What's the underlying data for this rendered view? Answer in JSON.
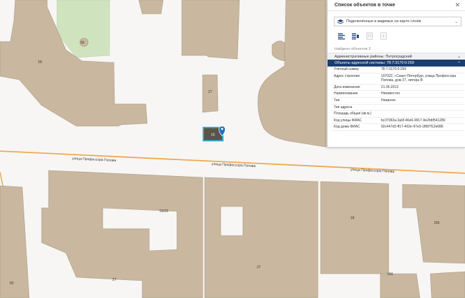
{
  "map": {
    "street_label": "улица Профессора Попова",
    "building_numbers": [
      "55",
      "55",
      "27",
      "15",
      "53/22",
      "18",
      "166",
      "166",
      "27",
      "27",
      "50"
    ],
    "colors": {
      "background": "#f7f6f4",
      "building": "#c9b89f",
      "building_outline": "#a89885",
      "park": "#cfe3bf",
      "street_line": "#f0a850",
      "highlight": "#3aa6c9",
      "marker": "#1e73be"
    },
    "marker_icon": "map-pin-icon"
  },
  "panel": {
    "title": "Список объектов в точке",
    "close_icon": "close-icon",
    "layer_select": {
      "icon": "layers-icon",
      "value": "Подключённые и видимых на карте слоёв"
    },
    "tools": [
      {
        "name": "list-view-icon",
        "enabled": true
      },
      {
        "name": "grouped-list-icon",
        "enabled": true
      },
      {
        "name": "document-icon",
        "enabled": false
      },
      {
        "name": "copy-icon",
        "enabled": false
      }
    ],
    "found_text": "Найдено объектов 2",
    "sections": [
      {
        "label": "Административные районы: Петроградский",
        "state": "collapsed"
      },
      {
        "label": "Объекты адресной системы: 78:7:3170:0:269",
        "state": "expanded"
      }
    ],
    "properties": [
      {
        "key": "Учетный номер",
        "value": "78:7:3170:0:269"
      },
      {
        "key": "Адрес строения",
        "value": "197022, г.Санкт-Петербург, улица Профессора Попова, дом 27, литера В"
      },
      {
        "key": "Дата изменения",
        "value": "21.05.2013"
      },
      {
        "key": "Наименование",
        "value": "Неизвестно"
      },
      {
        "key": "Тип",
        "value": "Нежилое"
      },
      {
        "key": "Тип адреса",
        "value": ""
      },
      {
        "key": "Площадь общая (кв.м.)",
        "value": ""
      },
      {
        "key": "Код улицы ФИАС",
        "value": "bc37063a-3a0f-46e6-9917-9e2bbf541280"
      },
      {
        "key": "Код дома ФИАС",
        "value": "92c447d3-ff17-402e-97e3-1f887f13e086"
      }
    ]
  }
}
